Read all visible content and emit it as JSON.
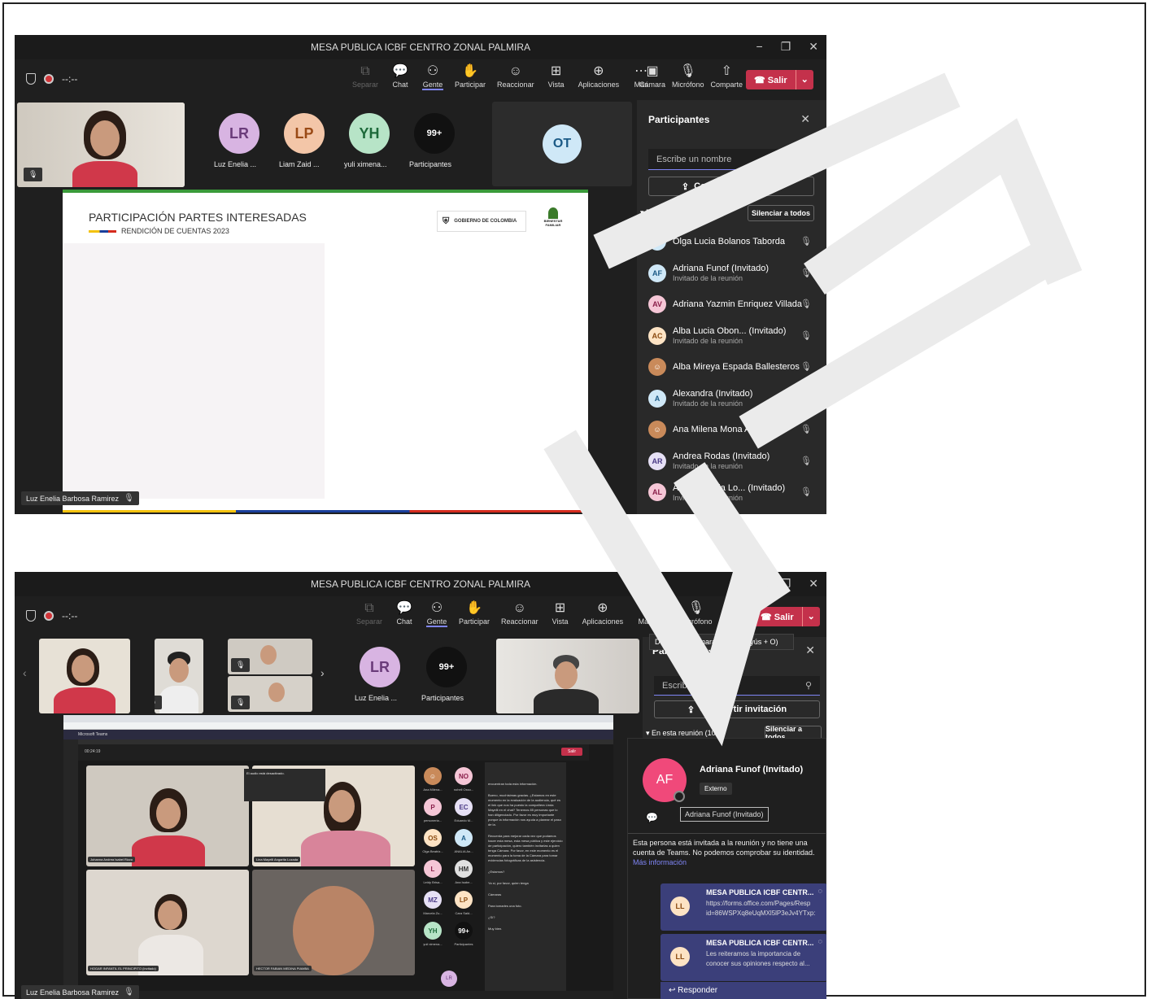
{
  "win1": {
    "title": "MESA PUBLICA ICBF CENTRO ZONAL PALMIRA",
    "timer": "--:--",
    "tools": [
      "Separar",
      "Chat",
      "Gente",
      "Participar",
      "Reaccionar",
      "Vista",
      "Aplicaciones",
      "Más"
    ],
    "devices": [
      "Cámara",
      "Micrófono",
      "Comparte"
    ],
    "leave": "Salir",
    "avatars": [
      {
        "initials": "LR",
        "label": "Luz Enelia ...",
        "color": "#d8b4e2",
        "text": "#6a3b7a"
      },
      {
        "initials": "LP",
        "label": "Liam Zaid ...",
        "color": "#f3c6a8",
        "text": "#9a4a16"
      },
      {
        "initials": "YH",
        "label": "yuli ximena...",
        "color": "#b7e4c7",
        "text": "#1d6a3a"
      },
      {
        "initials": "99+",
        "label": "Participantes",
        "color": "#111",
        "text": "#fff"
      }
    ],
    "ot_tile": "OT",
    "slide_title": "PARTICIPACIÓN PARTES INTERESADAS",
    "slide_subtitle": "RENDICIÓN DE CUENTAS 2023",
    "slide_gov": "GOBIERNO DE COLOMBIA",
    "slide_ministry": "BIENESTAR FAMILIAR",
    "presenter": "Luz Enelia Barbosa Ramirez",
    "pane": {
      "title": "Participantes",
      "search": "Escribe un nombre",
      "invite": "Compartir invitación",
      "section": "En esta reunión (113)",
      "mute_all": "Silenciar a todos",
      "people": [
        {
          "initials": "OT",
          "name": "Olga Lucia Bolanos Taborda",
          "sub": "",
          "color": "#cfe8f7",
          "text": "#1b5a86"
        },
        {
          "initials": "AF",
          "name": "Adriana Funof (Invitado)",
          "sub": "Invitado de la reunión",
          "color": "#cfe8f7",
          "text": "#1b5a86"
        },
        {
          "initials": "AV",
          "name": "Adriana Yazmin Enriquez Villada",
          "sub": "",
          "color": "#f5c6d6",
          "text": "#8a1f4a"
        },
        {
          "initials": "AC",
          "name": "Alba Lucia Obon... (Invitado)",
          "sub": "Invitado de la reunión",
          "color": "#fde3c4",
          "text": "#8a4a10"
        },
        {
          "initials": "",
          "name": "Alba Mireya Espada Ballesteros",
          "sub": "",
          "color": "#c98a5a",
          "text": "#fff"
        },
        {
          "initials": "A",
          "name": "Alexandra (Invitado)",
          "sub": "Invitado de la reunión",
          "color": "#cfe8f7",
          "text": "#1b5a86"
        },
        {
          "initials": "",
          "name": "Ana Milena Mona Alvarez",
          "sub": "",
          "color": "#c98a5a",
          "text": "#fff"
        },
        {
          "initials": "AR",
          "name": "Andrea Rodas (Invitado)",
          "sub": "Invitado de la reunión",
          "color": "#e6e0f5",
          "text": "#4a3a86"
        },
        {
          "initials": "AL",
          "name": "Angela Maria Lo... (Invitado)",
          "sub": "Invitado de la reunión",
          "color": "#f5c6d6",
          "text": "#8a1f4a"
        }
      ]
    }
  },
  "win2": {
    "title": "MESA PUBLICA ICBF CENTRO ZONAL PALMIRA",
    "timer": "--:--",
    "tools": [
      "Separar",
      "Chat",
      "Gente",
      "Participar",
      "Reaccionar",
      "Vista",
      "Aplicaciones",
      "Más"
    ],
    "devices": [
      "Cámara",
      "Micrófono",
      "Comparte"
    ],
    "leave": "Salir",
    "tooltip": "Desactivar cámara (Ctrl + Mayús + O)",
    "avatars": [
      {
        "initials": "LR",
        "label": "Luz Enelia ...",
        "color": "#d8b4e2",
        "text": "#6a3b7a"
      },
      {
        "initials": "99+",
        "label": "Participantes",
        "color": "#111",
        "text": "#fff"
      }
    ],
    "presenter": "Luz Enelia Barbosa Ramirez",
    "pane": {
      "title": "Participantes",
      "search": "Escribe un nombre",
      "invite": "Compartir invitación",
      "section": "En esta reunión (103)",
      "mute_all": "Silenciar a todos"
    },
    "card": {
      "initials": "AF",
      "name": "Adriana Funof (Invitado)",
      "badge": "Externo",
      "hover": "Adriana Funof (Invitado)",
      "notice": "Esta persona está invitada a la reunión y no tiene una cuenta de Teams. No podemos comprobar su identidad.",
      "more": "Más información",
      "messages": [
        {
          "initials": "LL",
          "title": "MESA PUBLICA ICBF CENTR...",
          "line1": "https://forms.office.com/Pages/Resp",
          "line2": "id=86WSPXq8eUqMXl5lP3eJv4YTxp:"
        },
        {
          "initials": "LL",
          "title": "MESA PUBLICA ICBF CENTR...",
          "line1": "Les reiteramos la importancia de",
          "line2": "conocer sus opiniones respecto al..."
        }
      ],
      "reply": "Responder"
    },
    "inner_screen": {
      "app": "Microsoft Teams",
      "timer": "00:24:19",
      "leave": "Salir",
      "audio_title": "El audio está desactivado.",
      "tile_names": [
        "Johanna Andrea Isabel Rizzo",
        "Lina Mayelli Angarita Lozada",
        "HOGAR INFANTIL EL PRINCIPITO (Invitado)",
        "HECTOR FABIAN MEDINA PIAMBA"
      ],
      "grid": [
        {
          "initials": "",
          "label": "Ana Milena...",
          "color": "#c98a5a",
          "text": "#fff"
        },
        {
          "initials": "NO",
          "label": "nohell Osso...",
          "color": "#f5c6d6",
          "text": "#8a1f4a"
        },
        {
          "initials": "P",
          "label": "personeria...",
          "color": "#f5c6d6",
          "text": "#8a1f4a"
        },
        {
          "initials": "EC",
          "label": "Eduardo M...",
          "color": "#e6e0f5",
          "text": "#4a3a86"
        },
        {
          "initials": "OS",
          "label": "Olga Beatriz...",
          "color": "#fde3c4",
          "text": "#8a4a10"
        },
        {
          "initials": "A",
          "label": "ANALIA An...",
          "color": "#cfe8f7",
          "text": "#1b5a86"
        },
        {
          "initials": "L",
          "label": "Leidy Brisa...",
          "color": "#f5c6d6",
          "text": "#8a1f4a"
        },
        {
          "initials": "HM",
          "label": "Ana Isabe...",
          "color": "#e0e0e0",
          "text": "#333"
        },
        {
          "initials": "MZ",
          "label": "Marcela Zu...",
          "color": "#e6e0f5",
          "text": "#4a3a86"
        },
        {
          "initials": "LP",
          "label": "Cara Sald...",
          "color": "#fde3c4",
          "text": "#8a4a10"
        },
        {
          "initials": "YH",
          "label": "yuli ximena...",
          "color": "#b7e4c7",
          "text": "#1d6a3a"
        },
        {
          "initials": "99+",
          "label": "Participantes",
          "color": "#111",
          "text": "#fff"
        }
      ],
      "chat_intro": "encuentran toda esta información.",
      "chat_body": "Bueno, muchísimas gracias. ¿Estamos en este momento en la evaluación de la audiencia, qué es el link que nos ha puesto la compañera Linda Mayelli en el chat? Tenemos 85 personas que lo han diligenciado. Por favor es muy importante porque la información nos ayuda a planear el paso de la.",
      "chat_body2": "Recuerda para mejorar cada vez que podamos hacer esta mesa, esta mesa pública y este ejercicio de participación, quiero también invitarlas a quien tenga Cámara. Por favor, en este momento es el momento para la toma de la Cámara para tomar evidencias fotográficas de la asistencia.",
      "chat_lines": [
        "¿Estamos?",
        "Ya sí, por favor, quien tenga",
        "Cámaras",
        "Para tomarles una foto.",
        "¿Sí?",
        "Muy bien."
      ],
      "lr": "LR"
    }
  }
}
